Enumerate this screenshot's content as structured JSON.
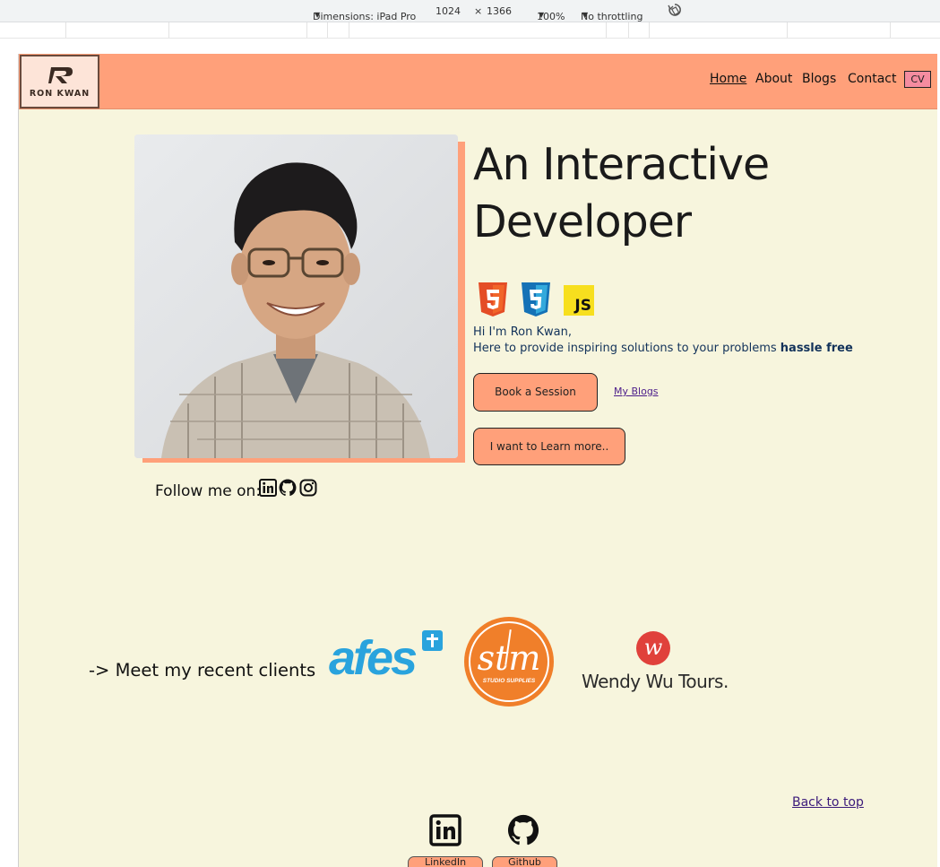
{
  "devtools": {
    "dimensions_label": "Dimensions: iPad Pro",
    "width": "1024",
    "times": "×",
    "height": "1366",
    "zoom": "100%",
    "throttling": "No throttling",
    "rotate_icon": "rotate-icon"
  },
  "header": {
    "logo_text": "RON KWAN",
    "nav": [
      "Home",
      "About",
      "Blogs",
      "Contact"
    ],
    "cv_label": "CV",
    "colors": {
      "header_bg": "#ffa07a",
      "page_bg": "#f7f5dd"
    }
  },
  "hero": {
    "title_line1": "An Interactive",
    "title_line2": "Developer",
    "tech_icons": [
      "html5-icon",
      "css3-icon",
      "javascript-icon"
    ],
    "js_label": "JS",
    "intro_line1": "Hi I'm Ron Kwan,",
    "intro_line2": "Here to provide inspiring solutions to your problems ",
    "intro_bold": "hassle free",
    "book_label": "Book a Session",
    "blogs_link": "My Blogs",
    "learn_label": "I want to Learn more..",
    "follow_label": "Follow me on:",
    "social_icons": [
      "linkedin-icon",
      "github-icon",
      "instagram-icon"
    ]
  },
  "clients": {
    "label": "-> Meet my recent clients",
    "logos": [
      {
        "name": "afes",
        "text": "afes"
      },
      {
        "name": "stm",
        "text": "stm",
        "sub": "STUDIO SUPPLIES"
      },
      {
        "name": "wendy-wu",
        "text": "Wendy Wu Tours."
      }
    ]
  },
  "footer": {
    "back_to_top": "Back to top",
    "linkedin_label": "LinkedIn",
    "github_label": "Github"
  }
}
